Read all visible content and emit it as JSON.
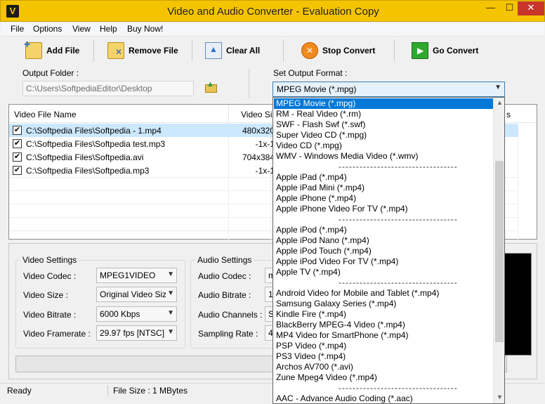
{
  "window": {
    "app_icon": "V",
    "title": "Video and Audio Converter - Evaluation Copy",
    "min_glyph": "—",
    "max_glyph": "☐",
    "close_glyph": "✕"
  },
  "menu": [
    "File",
    "Options",
    "View",
    "Help",
    "Buy Now!"
  ],
  "toolbar": {
    "add_file": "Add File",
    "remove_file": "Remove File",
    "clear_all": "Clear All",
    "stop_convert": "Stop Convert",
    "go_convert": "Go Convert"
  },
  "output": {
    "folder_label": "Output Folder :",
    "folder_value": "C:\\Users\\SoftpediaEditor\\Desktop",
    "format_label": "Set Output Format :",
    "format_value": "MPEG Movie (*.mpg)"
  },
  "file_list": {
    "columns": [
      "Video File Name",
      "Video Siz",
      "s"
    ],
    "rows": [
      {
        "name": "C:\\Softpedia Files\\Softpedia - 1.mp4",
        "size": "480x320",
        "checked": true
      },
      {
        "name": "C:\\Softpedia Files\\Softpedia test.mp3",
        "size": "-1x-1",
        "checked": true
      },
      {
        "name": "C:\\Softpedia Files\\Softpedia.avi",
        "size": "704x384",
        "checked": true
      },
      {
        "name": "C:\\Softpedia Files\\Softpedia.mp3",
        "size": "-1x-1",
        "checked": true
      }
    ]
  },
  "video_settings": {
    "title": "Video Settings",
    "codec_label": "Video Codec :",
    "codec_value": "MPEG1VIDEO",
    "size_label": "Video Size :",
    "size_value": "Original Video Siz",
    "bitrate_label": "Video Bitrate :",
    "bitrate_value": "6000 Kbps",
    "framerate_label": "Video Framerate :",
    "framerate_value": "29.97 fps [NTSC]"
  },
  "audio_settings": {
    "title": "Audio Settings",
    "codec_label": "Audio Codec :",
    "codec_value": "m",
    "bitrate_label": "Audio Bitrate :",
    "bitrate_value": "1",
    "channels_label": "Audio Channels :",
    "channels_value": "S",
    "sampling_label": "Sampling Rate :",
    "sampling_value": "4"
  },
  "status": {
    "ready": "Ready",
    "file_size": "File Size : 1 MBytes"
  },
  "format_options": [
    {
      "label": "MPEG Movie (*.mpg)",
      "selected": true
    },
    {
      "label": "RM - Real Video (*.rm)"
    },
    {
      "label": "SWF - Flash Swf (*.swf)"
    },
    {
      "label": "Super Video CD (*.mpg)"
    },
    {
      "label": "Video CD (*.mpg)"
    },
    {
      "label": "WMV - Windows Media Video (*.wmv)"
    },
    {
      "label": "----------------------------------",
      "divider": true
    },
    {
      "label": "Apple iPad (*.mp4)"
    },
    {
      "label": "Apple iPad Mini (*.mp4)"
    },
    {
      "label": "Apple iPhone (*.mp4)"
    },
    {
      "label": "Apple iPhone Video For TV (*.mp4)"
    },
    {
      "label": "----------------------------------",
      "divider": true
    },
    {
      "label": "Apple iPod (*.mp4)"
    },
    {
      "label": "Apple iPod Nano (*.mp4)"
    },
    {
      "label": "Apple iPod Touch (*.mp4)"
    },
    {
      "label": "Apple iPod Video For TV (*.mp4)"
    },
    {
      "label": "Apple TV (*.mp4)"
    },
    {
      "label": "----------------------------------",
      "divider": true
    },
    {
      "label": "Android Video for Mobile and Tablet (*.mp4)"
    },
    {
      "label": "Samsung Galaxy Series (*.mp4)"
    },
    {
      "label": "Kindle Fire (*.mp4)"
    },
    {
      "label": "BlackBerry MPEG-4 Video (*.mp4)"
    },
    {
      "label": "MP4 Video for SmartPhone (*.mp4)"
    },
    {
      "label": "PSP Video (*.mp4)"
    },
    {
      "label": "PS3 Video (*.mp4)"
    },
    {
      "label": "Archos AV700 (*.avi)"
    },
    {
      "label": "Zune Mpeg4 Video (*.mp4)"
    },
    {
      "label": "----------------------------------",
      "divider": true
    },
    {
      "label": "AAC - Advance Audio Coding (*.aac)"
    }
  ],
  "glyphs": {
    "check": "✔",
    "chevron_down": "▼",
    "scroll_up": "▲",
    "scroll_down": "▼"
  }
}
